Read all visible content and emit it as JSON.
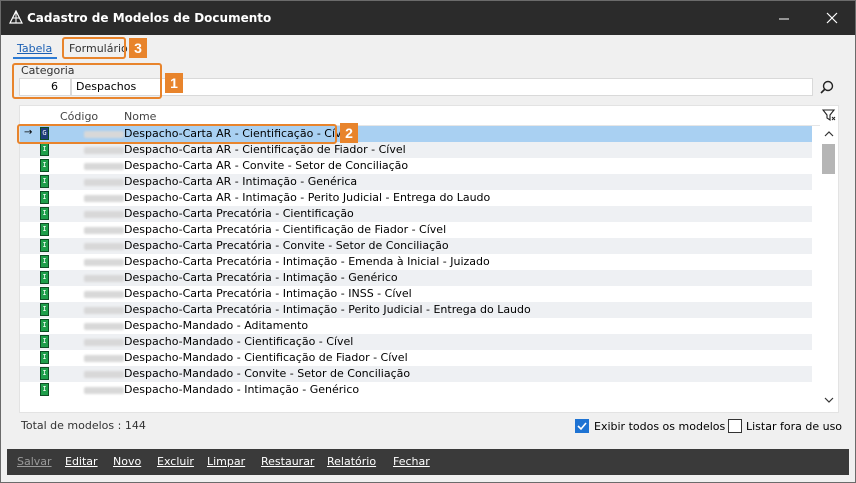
{
  "window": {
    "title": "Cadastro de Modelos de Documento",
    "icon": "app-pyramid-icon"
  },
  "tabs": [
    {
      "label": "Tabela",
      "active": true
    },
    {
      "label": "Formulário",
      "active": false
    }
  ],
  "markers": [
    "1",
    "2",
    "3"
  ],
  "categoria": {
    "label": "Categoria",
    "code": "6",
    "name": "Despachos"
  },
  "grid": {
    "headers": {
      "codigo": "Código",
      "nome": "Nome"
    },
    "rows": [
      {
        "name": "Despacho-Carta AR - Cientificação - Cível",
        "type": "G",
        "selected": true
      },
      {
        "name": "Despacho-Carta AR - Cientificação de Fiador - Cível",
        "type": "I"
      },
      {
        "name": "Despacho-Carta AR - Convite - Setor de Conciliação",
        "type": "I"
      },
      {
        "name": "Despacho-Carta AR - Intimação - Genérica",
        "type": "I"
      },
      {
        "name": "Despacho-Carta AR - Intimação - Perito Judicial - Entrega do Laudo",
        "type": "I"
      },
      {
        "name": "Despacho-Carta Precatória - Cientificação",
        "type": "I"
      },
      {
        "name": "Despacho-Carta Precatória - Cientificação de Fiador - Cível",
        "type": "I"
      },
      {
        "name": "Despacho-Carta Precatória - Convite - Setor de Conciliação",
        "type": "I"
      },
      {
        "name": "Despacho-Carta Precatória - Intimação - Emenda à Inicial - Juizado",
        "type": "I"
      },
      {
        "name": "Despacho-Carta Precatória - Intimação - Genérico",
        "type": "I"
      },
      {
        "name": "Despacho-Carta Precatória - Intimação - INSS - Cível",
        "type": "I"
      },
      {
        "name": "Despacho-Carta Precatória - Intimação - Perito Judicial - Entrega do Laudo",
        "type": "I"
      },
      {
        "name": "Despacho-Mandado - Aditamento",
        "type": "I"
      },
      {
        "name": "Despacho-Mandado - Cientificação - Cível",
        "type": "I"
      },
      {
        "name": "Despacho-Mandado - Cientificação de Fiador - Cível",
        "type": "I"
      },
      {
        "name": "Despacho-Mandado - Convite - Setor de Conciliação",
        "type": "I"
      },
      {
        "name": "Despacho-Mandado - Intimação - Genérico",
        "type": "I"
      }
    ]
  },
  "status": {
    "total": "Total de modelos : 144",
    "show_all_label": "Exibir todos os modelos",
    "show_all_checked": true,
    "list_unused_label": "Listar fora de uso",
    "list_unused_checked": false
  },
  "footer": {
    "salvar": "Salvar",
    "editar": "Editar",
    "novo": "Novo",
    "excluir": "Excluir",
    "limpar": "Limpar",
    "restaurar": "Restaurar",
    "relatorio": "Relatório",
    "fechar": "Fechar"
  },
  "colors": {
    "accent": "#1e73d3",
    "marker": "#e8842c",
    "selection": "#a9d0f2",
    "type_icon": "#1e9e4a"
  }
}
